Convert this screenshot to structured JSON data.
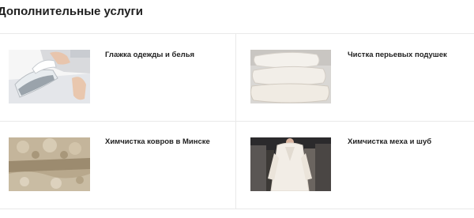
{
  "section": {
    "title": "Дополнительные услуги"
  },
  "services": [
    {
      "title": "Глажка одежды и белья",
      "image": "ironing-photo"
    },
    {
      "title": "Чистка перьевых подушек",
      "image": "pillows-photo"
    },
    {
      "title": "Химчистка ковров в Минске",
      "image": "carpet-photo"
    },
    {
      "title": "Химчистка меха и шуб",
      "image": "fur-coat-photo"
    }
  ],
  "colors": {
    "text": "#1f1f1f",
    "divider": "#e9e9e9",
    "background": "#ffffff"
  }
}
